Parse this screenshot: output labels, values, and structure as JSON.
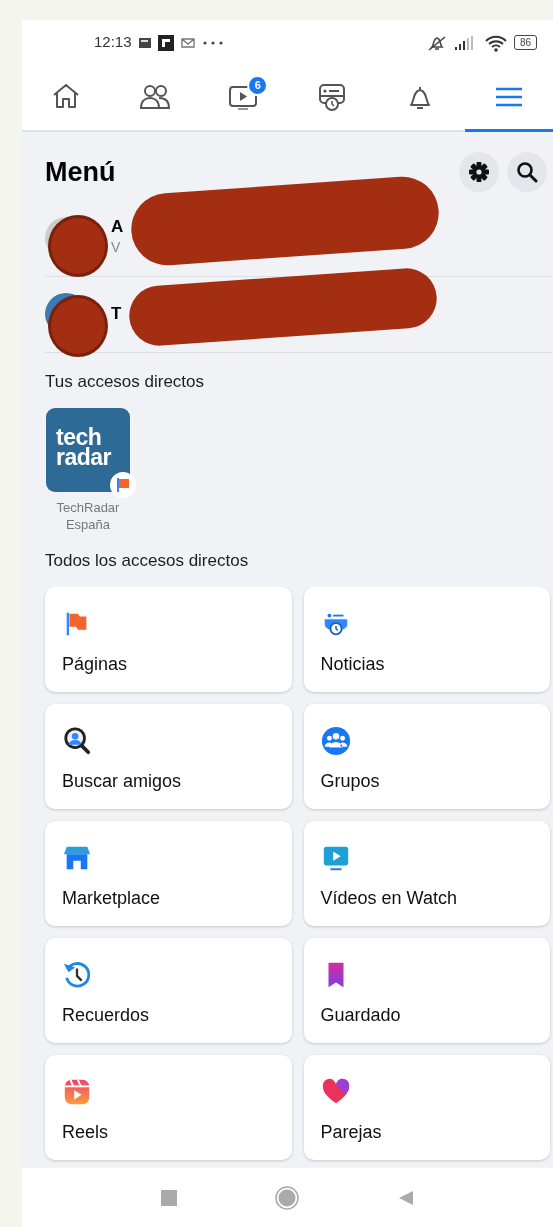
{
  "status_bar": {
    "time": "12:13",
    "battery": "86"
  },
  "nav_tabs": [
    {
      "kind": "home",
      "selected": false
    },
    {
      "kind": "friends",
      "selected": false
    },
    {
      "kind": "watch",
      "selected": false,
      "badge": "6"
    },
    {
      "kind": "feeds",
      "selected": false
    },
    {
      "kind": "bell",
      "selected": false
    },
    {
      "kind": "menu",
      "selected": true
    }
  ],
  "title": "Menú",
  "profiles": [
    {
      "name": "A",
      "subtitle": "V"
    },
    {
      "name": "T"
    }
  ],
  "your_shortcuts": {
    "heading": "Tus accesos directos",
    "items": [
      {
        "logo_lines": [
          "tech",
          "radar"
        ],
        "label": "TechRadar España"
      }
    ]
  },
  "all_shortcuts": {
    "heading": "Todos los accesos directos",
    "items": [
      {
        "kind": "flag",
        "label": "Páginas"
      },
      {
        "kind": "news",
        "label": "Noticias"
      },
      {
        "kind": "find",
        "label": "Buscar amigos"
      },
      {
        "kind": "groups",
        "label": "Grupos"
      },
      {
        "kind": "store",
        "label": "Marketplace"
      },
      {
        "kind": "video",
        "label": "Vídeos en Watch"
      },
      {
        "kind": "memories",
        "label": "Recuerdos"
      },
      {
        "kind": "bookmark",
        "label": "Guardado"
      },
      {
        "kind": "reels",
        "label": "Reels"
      },
      {
        "kind": "heart",
        "label": "Parejas"
      }
    ]
  }
}
